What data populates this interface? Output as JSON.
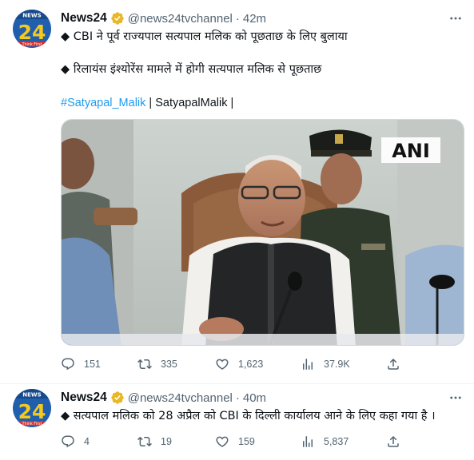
{
  "tweets": [
    {
      "author": {
        "name": "News24",
        "handle": "@news24tvchannel",
        "time": "42m",
        "avatar_top": "NEWS",
        "avatar_num": "24",
        "avatar_sub": "Think First"
      },
      "lines": [
        "◆  CBI ने पूर्व राज्यपाल सत्यपाल मलिक को पूछताछ के लिए बुलाया",
        "◆  रिलायंस इंश्योरेंस मामले में होगी सत्यपाल मलिक से पूछताछ"
      ],
      "hashtag": "#Satyapal_Malik",
      "tag_rest": " | SatyapalMalik |",
      "media": {
        "watermark": "ANI"
      },
      "stats": {
        "replies": "151",
        "retweets": "335",
        "likes": "1,623",
        "views": "37.9K"
      }
    },
    {
      "author": {
        "name": "News24",
        "handle": "@news24tvchannel",
        "time": "40m",
        "avatar_top": "NEWS",
        "avatar_num": "24",
        "avatar_sub": "Think First"
      },
      "lines": [
        "◆ सत्यपाल मलिक को 28 अप्रैल को CBI के दिल्ली कार्यालय आने के लिए कहा गया है ।"
      ],
      "stats": {
        "replies": "4",
        "retweets": "19",
        "likes": "159",
        "views": "5,837"
      }
    }
  ],
  "separator": "·",
  "colors": {
    "accent": "#1d9bf0",
    "secondary_text": "#536471",
    "verified_gold": "#e8b829",
    "avatar_blue": "#1f5fae"
  },
  "icons": [
    "verified-badge-icon",
    "more-options-icon",
    "reply-icon",
    "retweet-icon",
    "like-icon",
    "views-icon",
    "share-icon"
  ]
}
